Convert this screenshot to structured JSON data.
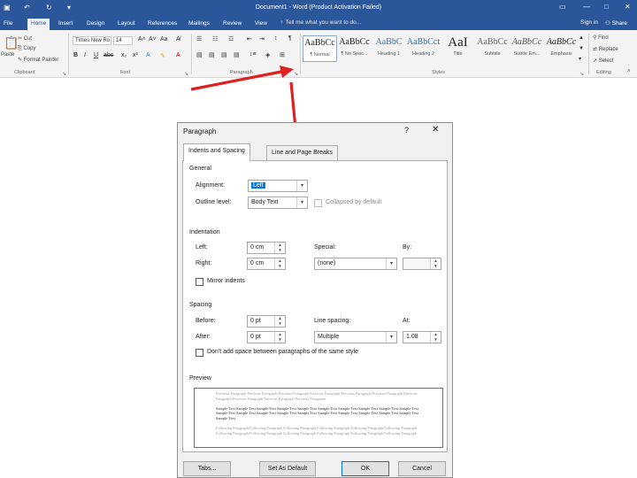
{
  "app": {
    "title": "Document1 - Word (Product Activation Failed)",
    "sign_in": "Sign in",
    "share": "Share",
    "tell_me": "Tell me what you want to do..."
  },
  "ribbon_tabs": [
    "File",
    "Home",
    "Insert",
    "Design",
    "Layout",
    "References",
    "Mailings",
    "Review",
    "View"
  ],
  "ribbon": {
    "clipboard": {
      "paste": "Paste",
      "cut": "Cut",
      "copy": "Copy",
      "format_painter": "Format Painter",
      "label": "Clipboard"
    },
    "font": {
      "name": "Times New Ro",
      "size": "14",
      "label": "Font"
    },
    "paragraph_label": "Paragraph",
    "styles_label": "Styles",
    "styles": [
      {
        "sample": "AaBbCc",
        "name": "¶ Normal"
      },
      {
        "sample": "AaBbCc",
        "name": "¶ No Spac..."
      },
      {
        "sample": "AaBbC",
        "name": "Heading 1"
      },
      {
        "sample": "AaBbCct",
        "name": "Heading 2"
      },
      {
        "sample": "AaI",
        "name": "Title"
      },
      {
        "sample": "AaBbCc",
        "name": "Subtitle"
      },
      {
        "sample": "AaBbCc",
        "name": "Subtle Em..."
      },
      {
        "sample": "AaBbCc",
        "name": "Emphasis"
      }
    ],
    "editing": {
      "find": "Find",
      "replace": "Replace",
      "select": "Select",
      "label": "Editing"
    }
  },
  "dialog": {
    "title": "Paragraph",
    "help": "?",
    "close": "✕",
    "tabs": [
      "Indents and Spacing",
      "Line and Page Breaks"
    ],
    "general": {
      "heading": "General",
      "alignment_label": "Alignment:",
      "alignment_value": "Left",
      "outline_label": "Outline level:",
      "outline_value": "Body Text",
      "collapsed_label": "Collapsed by default"
    },
    "indentation": {
      "heading": "Indentation",
      "left_label": "Left:",
      "left_value": "0 cm",
      "right_label": "Right:",
      "right_value": "0 cm",
      "special_label": "Special:",
      "special_value": "(none)",
      "by_label": "By:",
      "mirror_label": "Mirror indents"
    },
    "spacing": {
      "heading": "Spacing",
      "before_label": "Before:",
      "before_value": "0 pt",
      "after_label": "After:",
      "after_value": "0 pt",
      "line_spacing_label": "Line spacing:",
      "line_spacing_value": "Multiple",
      "at_label": "At:",
      "at_value": "1.08",
      "dont_add_label": "Don't add space between paragraphs of the same style"
    },
    "preview": {
      "heading": "Preview",
      "previous": "Previous Paragraph Previous Paragraph Previous Paragraph Previous Paragraph Previous Paragraph Previous Paragraph Previous Paragraph Previous Paragraph Previous Paragraph Previous Paragraph",
      "sample": "Sample Text Sample Text Sample Text Sample Text Sample Text Sample Text Sample Text Sample Text Sample Text Sample Text Sample Text Sample Text Sample Text Sample Text Sample Text Sample Text Sample Text Sample Text Sample Text Sample Text Sample Text",
      "following": "Following Paragraph Following Paragraph Following Paragraph Following Paragraph Following Paragraph Following Paragraph Following Paragraph Following Paragraph Following Paragraph Following Paragraph Following Paragraph Following Paragraph"
    },
    "buttons": {
      "tabs": "Tabs...",
      "set_default": "Set As Default",
      "ok": "OK",
      "cancel": "Cancel"
    }
  },
  "colors": {
    "word_blue": "#2b579a",
    "arrow_red": "#e02020",
    "selection": "#0078d7"
  }
}
